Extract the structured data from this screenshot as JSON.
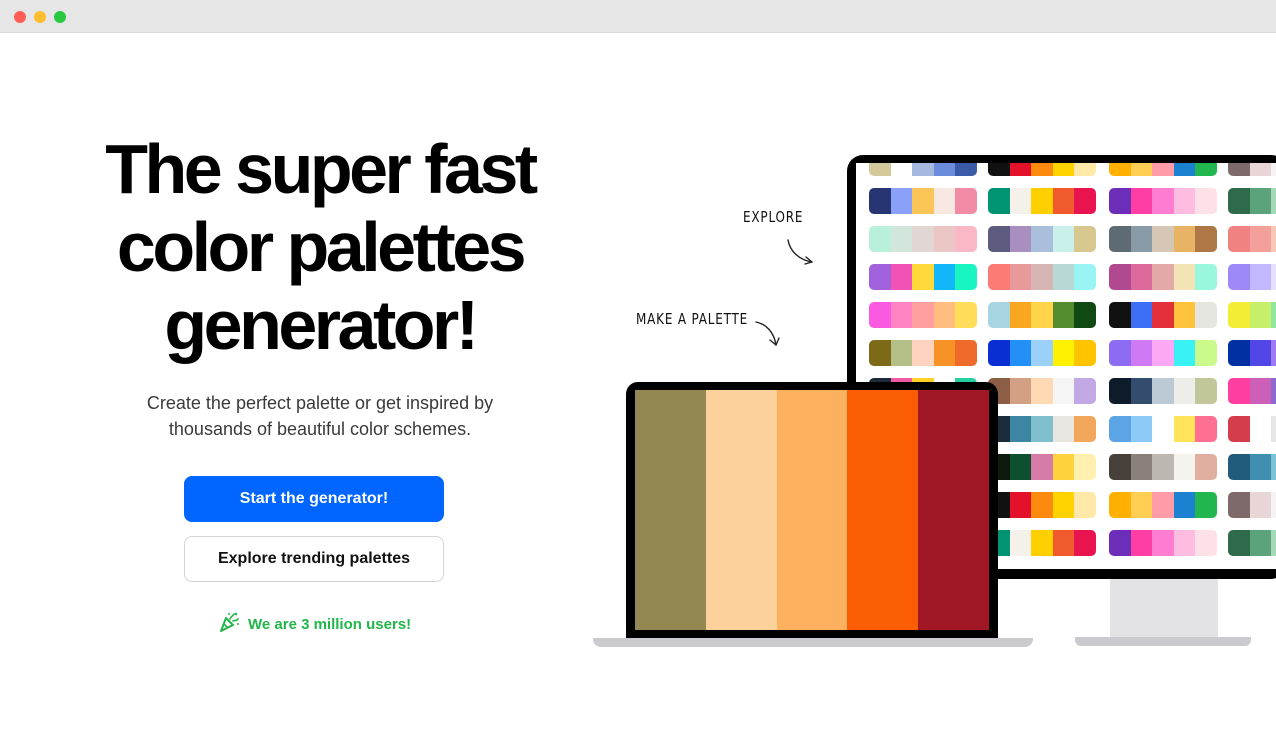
{
  "window": {
    "controls": [
      "close",
      "minimize",
      "maximize"
    ]
  },
  "hero": {
    "title_lines": [
      "The super fast",
      "color palettes",
      "generator!"
    ],
    "subtitle_lines": [
      "Create the perfect palette or get inspired by",
      "thousands of beautiful color schemes."
    ],
    "primary_button": "Start the generator!",
    "secondary_button": "Explore trending palettes",
    "users_text": "We are 3 million users!",
    "users_icon": "party-popper-icon"
  },
  "illustration": {
    "explore_label": "EXPLORE",
    "make_palette_label": "MAKE A PALETTE",
    "laptop_palette": [
      "#938752",
      "#FDD19C",
      "#FDB15F",
      "#FB5D03",
      "#A11726"
    ],
    "monitor_palettes": [
      [
        [
          "#D4C99A",
          "#FFFFFF",
          "#A4B8E0",
          "#6A8CDA",
          "#3B5BA9"
        ],
        [
          "#273572",
          "#8AA0F9",
          "#FBC657",
          "#F7E9E1",
          "#F28CA6"
        ],
        [
          "#B8F0DB",
          "#D3E6DC",
          "#E1D6D3",
          "#ECC6C4",
          "#FAB8C7"
        ],
        [
          "#A262DD",
          "#F052B6",
          "#FDD93A",
          "#12B6F9",
          "#18F5C2"
        ],
        [
          "#FB59E1",
          "#FF82C3",
          "#FF9F9F",
          "#FFBE80",
          "#FFDD59"
        ],
        [
          "#7D6A16",
          "#B5C089",
          "#FFD3BF",
          "#F79226",
          "#EF6B2B"
        ],
        [
          "#1D2A3A",
          "#F05AA0",
          "#FFD028",
          "#FFFFFF",
          "#25D0A0"
        ],
        [
          "#303A52",
          "#574B90",
          "#9E579D",
          "#FC85AE",
          "#F9D5E5"
        ],
        [
          "#6A994E",
          "#A7C957",
          "#F2E8CF",
          "#BC4749",
          "#386641"
        ],
        [
          "#003049",
          "#D62828",
          "#F77F00",
          "#FCBF49",
          "#EAE2B7"
        ],
        [
          "#D4C99A",
          "#FFFFFF",
          "#A4B8E0",
          "#6A8CDA",
          "#3B5BA9"
        ]
      ],
      [
        [
          "#111111",
          "#E3122A",
          "#FB8A0F",
          "#FFD200",
          "#FFE8A8"
        ],
        [
          "#009473",
          "#F4F0EA",
          "#FFCF00",
          "#F05A2D",
          "#E8134F"
        ],
        [
          "#5E5B81",
          "#A88FBF",
          "#A9BFDC",
          "#C9F0EA",
          "#D8C890"
        ],
        [
          "#FC7C75",
          "#E99999",
          "#D6B4B4",
          "#B8D8D5",
          "#99F4F4"
        ],
        [
          "#A8D5E2",
          "#F9A620",
          "#FFD449",
          "#548C2F",
          "#104911"
        ],
        [
          "#0A2ED1",
          "#2290F6",
          "#9BD1F9",
          "#FFF200",
          "#FFC300"
        ],
        [
          "#8C5E45",
          "#D2A184",
          "#FFD8B4",
          "#F5F5F5",
          "#C2A9E6"
        ],
        [
          "#1B2D3A",
          "#3D86A3",
          "#7FC0CC",
          "#E9E6E1",
          "#F2A65A"
        ],
        [
          "#0B1A0C",
          "#0D5030",
          "#D67BA8",
          "#FFD13C",
          "#FFF0B0"
        ],
        [
          "#111111",
          "#E3122A",
          "#FB8A0F",
          "#FFD200",
          "#FFE8A8"
        ],
        [
          "#009473",
          "#F4F0EA",
          "#FFCF00",
          "#F05A2D",
          "#E8134F"
        ]
      ],
      [
        [
          "#FFB000",
          "#FFCE52",
          "#FF9CA7",
          "#1A82D1",
          "#22B74E"
        ],
        [
          "#6C2EB8",
          "#FF3EA5",
          "#FF7DD1",
          "#FFBCE1",
          "#FEE0E9"
        ],
        [
          "#5F6B73",
          "#8A9BA8",
          "#D5C6B5",
          "#E9B365",
          "#AD7845"
        ],
        [
          "#B0498F",
          "#DC6A9A",
          "#E3A8A8",
          "#F2E4B4",
          "#98F7DC"
        ],
        [
          "#111111",
          "#3C6EF6",
          "#E3303B",
          "#FFC43C",
          "#E6E6E1"
        ],
        [
          "#8B6CF2",
          "#CF7AF4",
          "#FDA8F5",
          "#39F2F6",
          "#C9FA8B"
        ],
        [
          "#0D1B2A",
          "#344D6F",
          "#BCCAD6",
          "#EDEEEA",
          "#C2C79A"
        ],
        [
          "#5BA4E5",
          "#8DCAF8",
          "#FFFFFF",
          "#FFE45A",
          "#FF6F91"
        ],
        [
          "#463F3A",
          "#8A817C",
          "#BCB8B1",
          "#F4F3EE",
          "#E0AFA0"
        ],
        [
          "#FFB000",
          "#FFCE52",
          "#FF9CA7",
          "#1A82D1",
          "#22B74E"
        ],
        [
          "#6C2EB8",
          "#FF3EA5",
          "#FF7DD1",
          "#FFBCE1",
          "#FEE0E9"
        ]
      ],
      [
        [
          "#7E6A6A",
          "#E8D5D5",
          "#F4F4F4",
          "#C9C9C9",
          "#999999"
        ],
        [
          "#2F6B4B",
          "#5BA37A",
          "#A5D8B6",
          "#E3F5E8",
          "#FFFFFF"
        ],
        [
          "#F08282",
          "#F4A09A",
          "#F8C7B5",
          "#FCE7D2",
          "#FFF9EE"
        ],
        [
          "#9F89F8",
          "#C2B8FD",
          "#E7E1FF",
          "#FFDCE6",
          "#FCB5CB"
        ],
        [
          "#F4ED35",
          "#C7F06A",
          "#8FE7A0",
          "#5FD8C6",
          "#3BB5E0"
        ],
        [
          "#0030A1",
          "#5346E8",
          "#9F7BF3",
          "#E2B7F7",
          "#FFD3F0"
        ],
        [
          "#FF3FA0",
          "#CC5FB8",
          "#8C6AD0",
          "#4D7EE8",
          "#1A98F5"
        ],
        [
          "#D43D4C",
          "#FFFFFF",
          "#E6E6E6",
          "#2A2A2A",
          "#7A7A7A"
        ],
        [
          "#225B7C",
          "#3E8FB0",
          "#7BC2D6",
          "#C3E6EC",
          "#FCF7F0"
        ],
        [
          "#7E6A6A",
          "#E8D5D5",
          "#F4F4F4",
          "#C9C9C9",
          "#999999"
        ],
        [
          "#2F6B4B",
          "#5BA37A",
          "#A5D8B6",
          "#E3F5E8",
          "#FFFFFF"
        ]
      ]
    ]
  }
}
